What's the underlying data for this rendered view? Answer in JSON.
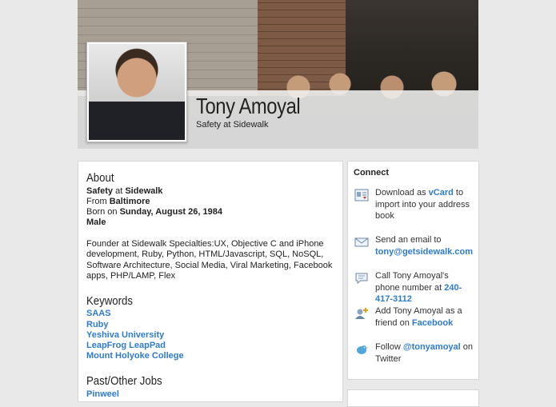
{
  "profile": {
    "name": "Tony Amoyal",
    "tagline": "Safety at Sidewalk"
  },
  "about": {
    "heading": "About",
    "role": "Safety",
    "at_word": "at",
    "company": "Sidewalk",
    "from_label": "From",
    "from_value": "Baltimore",
    "born_label": "Born on",
    "born_value": "Sunday, August 26, 1984",
    "gender": "Male",
    "bio": "Founder at Sidewalk Specialties:UX, Objective C and iPhone development, Ruby, Python, HTML/Javascript, SQL, NoSQL, Software Architecture, Social Media, Viral Marketing, Facebook apps, PHP/LAMP, Flex"
  },
  "keywords": {
    "heading": "Keywords",
    "items": [
      "SAAS",
      "Ruby",
      "Yeshiva University",
      "LeapFrog LeapPad",
      "Mount Holyoke College"
    ]
  },
  "jobs": {
    "heading": "Past/Other Jobs",
    "items": [
      "Pinweel"
    ]
  },
  "connect": {
    "title": "Connect",
    "vcard": {
      "pre": "Download as",
      "link": "vCard",
      "post": "to import into your address book"
    },
    "email": {
      "pre": "Send an email to",
      "link": "tony@getsidewalk.com"
    },
    "phone": {
      "pre": "Call Tony Amoyal's phone number at",
      "link": "240-417-3112"
    },
    "facebook": {
      "pre": "Add Tony Amoyal as a friend on",
      "link": "Facebook"
    },
    "twitter": {
      "pre": "Follow",
      "link": "@tonyamoyal",
      "post": "on Twitter"
    }
  },
  "colors": {
    "link": "#2e7bcf",
    "background": "#e9e9e9"
  }
}
